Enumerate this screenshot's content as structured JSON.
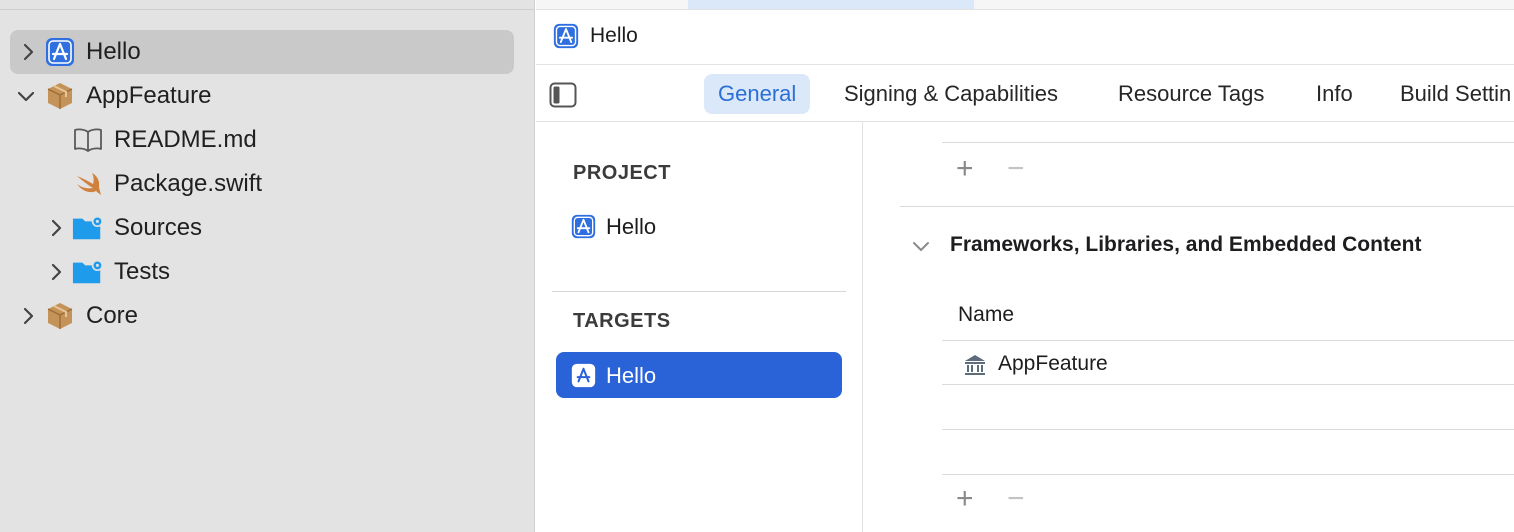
{
  "navigator": {
    "items": [
      {
        "label": "Hello",
        "icon": "app-target-icon",
        "selected": true,
        "disclosure": "collapsed"
      },
      {
        "label": "AppFeature",
        "icon": "package-icon",
        "disclosure": "expanded"
      },
      {
        "label": "README.md",
        "icon": "book-icon"
      },
      {
        "label": "Package.swift",
        "icon": "swift-icon"
      },
      {
        "label": "Sources",
        "icon": "folder-gear-icon",
        "disclosure": "collapsed"
      },
      {
        "label": "Tests",
        "icon": "folder-gear-icon",
        "disclosure": "collapsed"
      },
      {
        "label": "Core",
        "icon": "package-icon",
        "disclosure": "collapsed"
      }
    ]
  },
  "editor": {
    "jump_title": "Hello",
    "tabs": [
      "General",
      "Signing & Capabilities",
      "Resource Tags",
      "Info",
      "Build Settin"
    ],
    "active_tab": "General"
  },
  "project_list": {
    "project_header": "PROJECT",
    "project_item": "Hello",
    "targets_header": "TARGETS",
    "target_item": "Hello"
  },
  "frameworks": {
    "section_title": "Frameworks, Libraries, and Embedded Content",
    "column_name": "Name",
    "rows": [
      {
        "name": "AppFeature",
        "icon": "library-icon"
      }
    ],
    "add_symbol": "+",
    "remove_symbol": "−"
  },
  "colors": {
    "accent": "#2a62d7",
    "tab_active_bg": "#dbe8fa",
    "sidebar_bg": "#e3e3e3",
    "selection_gray": "#c9c9c9"
  }
}
